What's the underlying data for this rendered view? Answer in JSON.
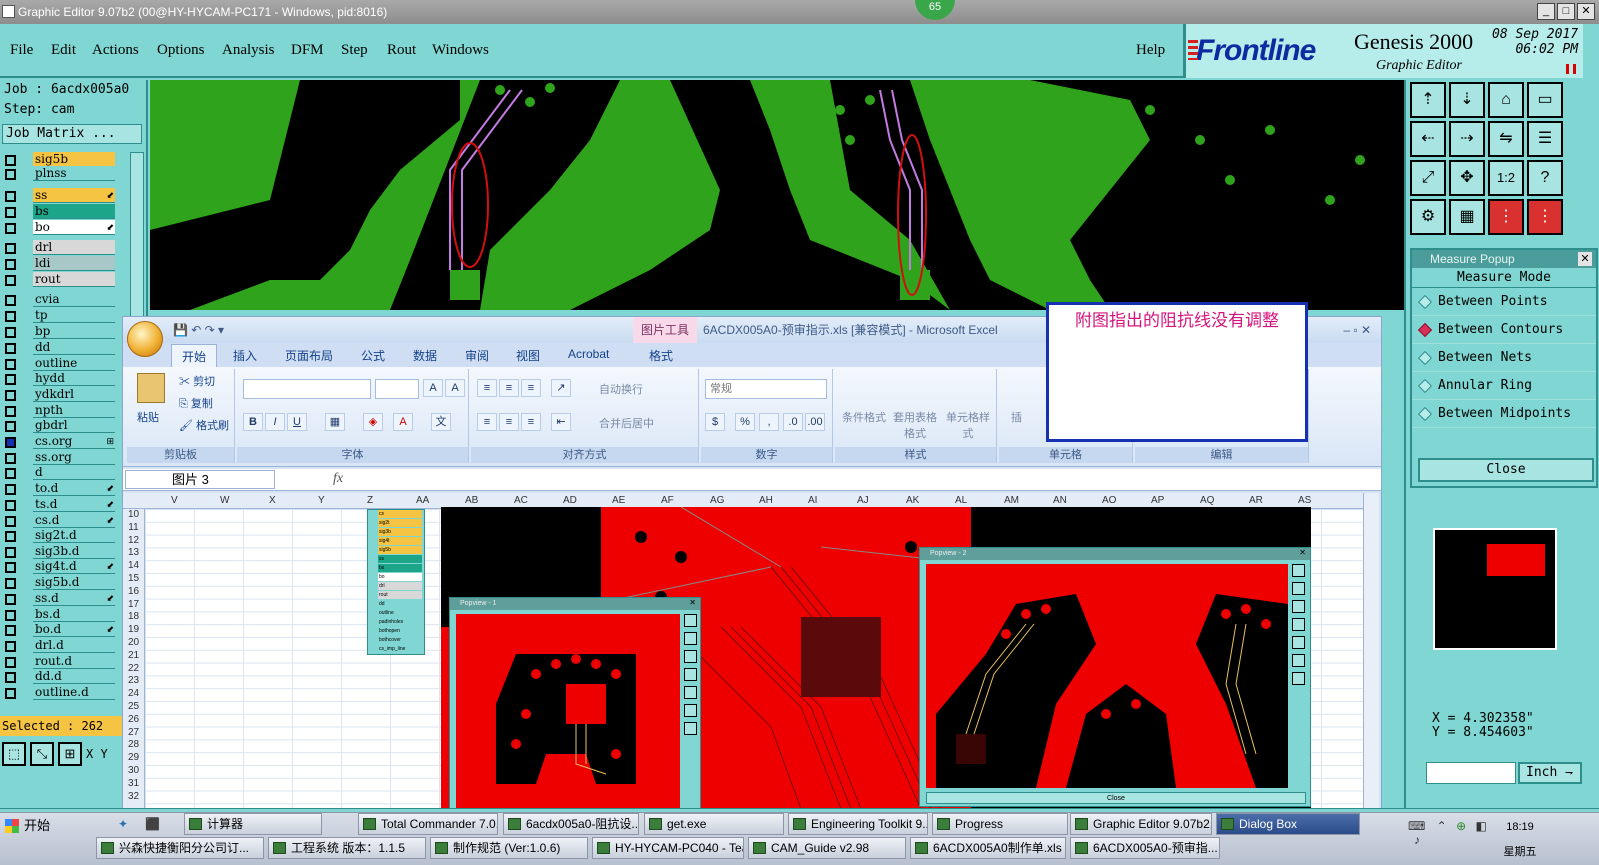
{
  "window": {
    "title": "Graphic Editor 9.07b2 (00@HY-HYCAM-PC171 - Windows, pid:8016)",
    "badge": "65",
    "controls": [
      "_",
      "□",
      "✕"
    ]
  },
  "menu": {
    "items": [
      "File",
      "Edit",
      "Actions",
      "Options",
      "Analysis",
      "DFM",
      "Step",
      "Rout",
      "Windows"
    ],
    "help": "Help"
  },
  "brand": {
    "logo": "Frontline",
    "product": "Genesis 2000",
    "subtitle": "Graphic Editor",
    "date": "08 Sep 2017",
    "time": "06:02 PM"
  },
  "job": {
    "job_line": "Job : 6acdx005a0",
    "step_line": "Step: cam",
    "matrix_button": "Job Matrix ..."
  },
  "layers": [
    {
      "name": "sig5b",
      "color": "#f5c443",
      "arrow": ""
    },
    {
      "name": "plnss",
      "color": "#7fd6d2",
      "arrow": ""
    },
    {
      "name": "ss",
      "color": "#f5c443",
      "arrow": "⬋"
    },
    {
      "name": "bs",
      "color": "#1da58a",
      "arrow": ""
    },
    {
      "name": "bo",
      "color": "#ffffff",
      "arrow": "⬋"
    },
    {
      "name": "drl",
      "color": "#d8d8d8",
      "arrow": ""
    },
    {
      "name": "ldi",
      "color": "#a8c8c8",
      "arrow": ""
    },
    {
      "name": "rout",
      "color": "#d8d8d8",
      "arrow": ""
    },
    {
      "name": "cvia",
      "color": "#7fd6d2",
      "arrow": ""
    },
    {
      "name": "tp",
      "color": "#7fd6d2",
      "arrow": ""
    },
    {
      "name": "bp",
      "color": "#7fd6d2",
      "arrow": ""
    },
    {
      "name": "dd",
      "color": "#7fd6d2",
      "arrow": ""
    },
    {
      "name": "outline",
      "color": "#7fd6d2",
      "arrow": ""
    },
    {
      "name": "hydd",
      "color": "#7fd6d2",
      "arrow": ""
    },
    {
      "name": "ydkdrl",
      "color": "#7fd6d2",
      "arrow": ""
    },
    {
      "name": "npth",
      "color": "#7fd6d2",
      "arrow": ""
    },
    {
      "name": "gbdrl",
      "color": "#7fd6d2",
      "arrow": ""
    },
    {
      "name": "cs.org",
      "color": "#7fd6d2",
      "arrow": "⊞"
    },
    {
      "name": "ss.org",
      "color": "#7fd6d2",
      "arrow": ""
    },
    {
      "name": "d",
      "color": "#7fd6d2",
      "arrow": ""
    },
    {
      "name": "to.d",
      "color": "#7fd6d2",
      "arrow": "⬋"
    },
    {
      "name": "ts.d",
      "color": "#7fd6d2",
      "arrow": "⬋"
    },
    {
      "name": "cs.d",
      "color": "#7fd6d2",
      "arrow": "⬋"
    },
    {
      "name": "sig2t.d",
      "color": "#7fd6d2",
      "arrow": ""
    },
    {
      "name": "sig3b.d",
      "color": "#7fd6d2",
      "arrow": ""
    },
    {
      "name": "sig4t.d",
      "color": "#7fd6d2",
      "arrow": "⬋"
    },
    {
      "name": "sig5b.d",
      "color": "#7fd6d2",
      "arrow": ""
    },
    {
      "name": "ss.d",
      "color": "#7fd6d2",
      "arrow": "⬋"
    },
    {
      "name": "bs.d",
      "color": "#7fd6d2",
      "arrow": ""
    },
    {
      "name": "bo.d",
      "color": "#7fd6d2",
      "arrow": "⬋"
    },
    {
      "name": "drl.d",
      "color": "#7fd6d2",
      "arrow": ""
    },
    {
      "name": "rout.d",
      "color": "#7fd6d2",
      "arrow": ""
    },
    {
      "name": "dd.d",
      "color": "#7fd6d2",
      "arrow": ""
    },
    {
      "name": "outline.d",
      "color": "#7fd6d2",
      "arrow": ""
    }
  ],
  "selected": "Selected : 262",
  "xy_label": "X Y",
  "measure": {
    "title": "Measure Popup",
    "mode_label": "Measure Mode",
    "options": [
      "Between Points",
      "Between Contours",
      "Between Nets",
      "Annular Ring",
      "Between Midpoints"
    ],
    "selected_option": "Between Contours",
    "close": "Close",
    "x": "X = 4.302358\"",
    "y": "Y = 8.454603\"",
    "unit": "Inch"
  },
  "note": "附图指出的阻抗线没有调整",
  "excel": {
    "picture_tools": "图片工具",
    "caption": "6ACDX005A0-预审指示.xls  [兼容模式] - Microsoft Excel",
    "tabs": [
      "开始",
      "插入",
      "页面布局",
      "公式",
      "数据",
      "审阅",
      "视图",
      "Acrobat",
      "格式"
    ],
    "groups": [
      "剪贴板",
      "字体",
      "对齐方式",
      "数字",
      "样式",
      "单元格",
      "编辑"
    ],
    "clipboard": {
      "paste": "粘贴",
      "cut": "剪切",
      "copy": "复制",
      "format_painter": "格式刷"
    },
    "alignment": {
      "wrap": "自动换行",
      "merge": "合并后居中"
    },
    "number_format": "常规",
    "styles": {
      "conditional": "条件格式",
      "table": "套用表格格式",
      "cell": "单元格样式"
    },
    "insert": "插",
    "sort": "和",
    "name_box": "图片 3",
    "fx": "fx",
    "columns": [
      "V",
      "W",
      "X",
      "Y",
      "Z",
      "AA",
      "AB",
      "AC",
      "AD",
      "AE",
      "AF",
      "AG",
      "AH",
      "AI",
      "AJ",
      "AK",
      "AL",
      "AM",
      "AN",
      "AO",
      "AP",
      "AQ",
      "AR",
      "AS"
    ],
    "rows": [
      "10",
      "11",
      "12",
      "13",
      "14",
      "15",
      "16",
      "17",
      "18",
      "19",
      "20",
      "21",
      "22",
      "23",
      "24",
      "25",
      "26",
      "27",
      "28",
      "29",
      "30",
      "31",
      "32"
    ],
    "popview1": "Popview - 1",
    "popview2": "Popview - 2",
    "popview_close": "Close",
    "mini_layers": [
      "cs",
      "sig2t",
      "sig3b",
      "sig4t",
      "sig5b",
      "ss",
      "bs",
      "bo",
      "drl",
      "rout",
      "dd",
      "outline",
      "padinholes",
      "bothopen",
      "bothcover",
      "cs_imp_line"
    ]
  },
  "taskbar": {
    "start": "开始",
    "row1": [
      "计算器",
      "Total Commander 7.0...",
      "6acdx005a0-阻抗设...",
      "get.exe",
      "Engineering Toolkit 9....",
      "Progress",
      "Graphic Editor 9.07b2...",
      "Dialog Box"
    ],
    "row2": [
      "兴森快捷衡阳分公司订...",
      "工程系统  版本：1.1.5",
      "制作规范 (Ver:1.0.6)",
      "HY-HYCAM-PC040 - Tea...",
      "CAM_Guide v2.98",
      "6ACDX005A0制作单.xls",
      "6ACDX005A0-预审指..."
    ],
    "time": "18:19",
    "day": "星期五"
  }
}
